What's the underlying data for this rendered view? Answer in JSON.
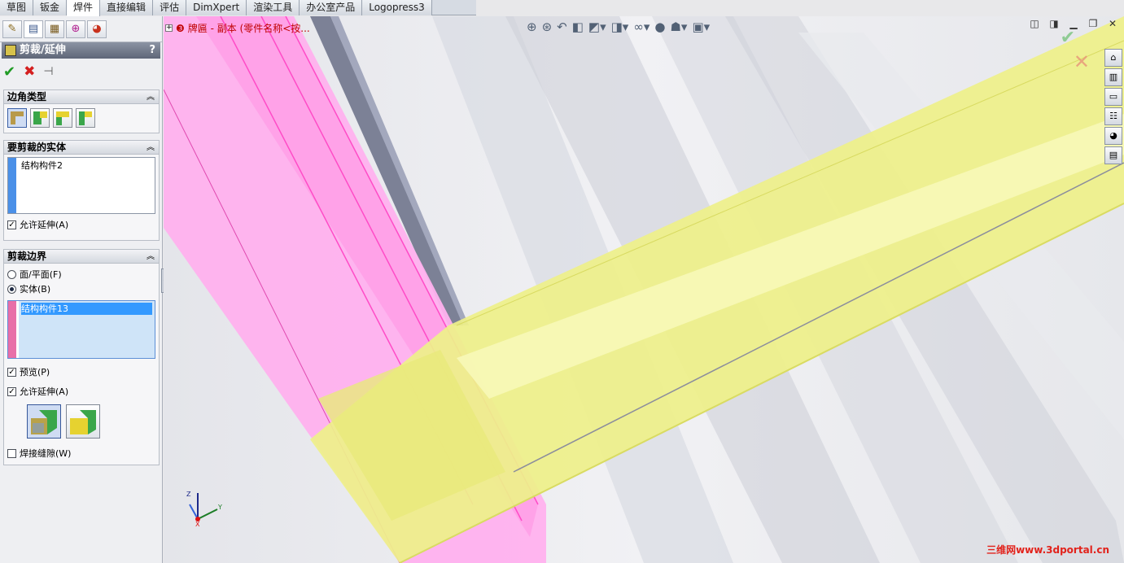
{
  "tabs": [
    "草图",
    "钣金",
    "焊件",
    "直接编辑",
    "评估",
    "DimXpert",
    "渲染工具",
    "办公室产品",
    "Logopress3"
  ],
  "active_tab": "焊件",
  "property_manager": {
    "title": "剪裁/延伸",
    "help": "?",
    "corner_type": {
      "header": "边角类型"
    },
    "bodies_to_trim": {
      "header": "要剪裁的实体",
      "items": [
        "结构构件2"
      ],
      "allow_extend_label": "允许延伸(A)",
      "allow_extend": true
    },
    "trimming_boundary": {
      "header": "剪裁边界",
      "face_plane_label": "面/平面(F)",
      "bodies_label": "实体(B)",
      "selected": "bodies",
      "items": [
        "结构构件13"
      ],
      "preview_label": "预览(P)",
      "preview": true,
      "allow_extend_label": "允许延伸(A)",
      "allow_extend": true,
      "weld_gap_label": "焊接缝隙(W)",
      "weld_gap": false
    }
  },
  "viewport": {
    "tree_label": "牌匾 - 副本 (零件名称<按..."
  },
  "watermark": "三维网www.3dportal.cn",
  "colors": {
    "pink_body": "#ff8fe0",
    "yellow_body": "#e8ec7a",
    "list_bar_blue": "#4a90e8",
    "list_bar_pink": "#e86fa8"
  }
}
